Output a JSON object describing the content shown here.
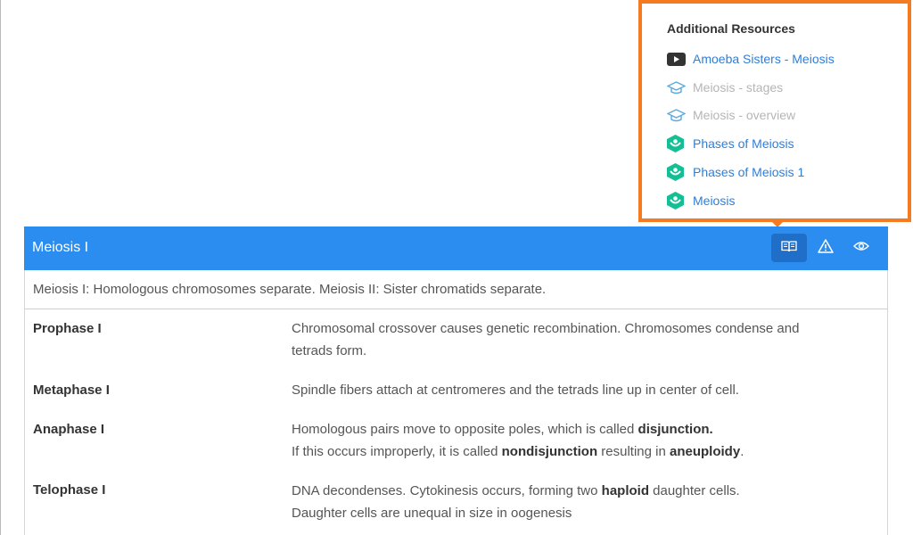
{
  "resources": {
    "title": "Additional Resources",
    "items": [
      {
        "label": "Amoeba Sisters - Meiosis",
        "icon": "youtube-icon",
        "state": "active"
      },
      {
        "label": "Meiosis - stages",
        "icon": "graduation-cap-icon",
        "state": "disabled"
      },
      {
        "label": "Meiosis - overview",
        "icon": "graduation-cap-icon",
        "state": "disabled"
      },
      {
        "label": "Phases of Meiosis",
        "icon": "khan-academy-icon",
        "state": "active"
      },
      {
        "label": "Phases of Meiosis 1",
        "icon": "khan-academy-icon",
        "state": "active"
      },
      {
        "label": "Meiosis",
        "icon": "khan-academy-icon",
        "state": "active"
      }
    ]
  },
  "card": {
    "title": "Meiosis I",
    "summary": "Meiosis I: Homologous chromosomes separate. Meiosis II: Sister chromatids separate.",
    "header_buttons": [
      "book-icon",
      "warning-icon",
      "eye-icon"
    ]
  },
  "rows": [
    {
      "term": "Prophase I",
      "line1": "Chromosomal crossover causes genetic recombination. Chromosomes condense and",
      "line2": "tetrads form."
    },
    {
      "term": "Metaphase I",
      "line1": "Spindle fibers attach at centromeres and the tetrads line up in center of cell."
    },
    {
      "term": "Anaphase I",
      "l1a": "Homologous pairs move to opposite poles, which is called ",
      "l1b": "disjunction.",
      "l2a": "If this occurs improperly, it is called ",
      "l2b": "nondisjunction",
      "l2c": " resulting in ",
      "l2d": "aneuploidy",
      "l2e": "."
    },
    {
      "term": "Telophase I",
      "l1a": "DNA decondenses. Cytokinesis occurs, forming two ",
      "l1b": "haploid",
      "l1c": " daughter cells.",
      "line2": "Daughter cells are unequal in size in oogenesis"
    }
  ],
  "colors": {
    "accent": "#2b8df0",
    "popover_border": "#f47b20",
    "link": "#2f7ed8",
    "khan_green": "#14bf96"
  }
}
